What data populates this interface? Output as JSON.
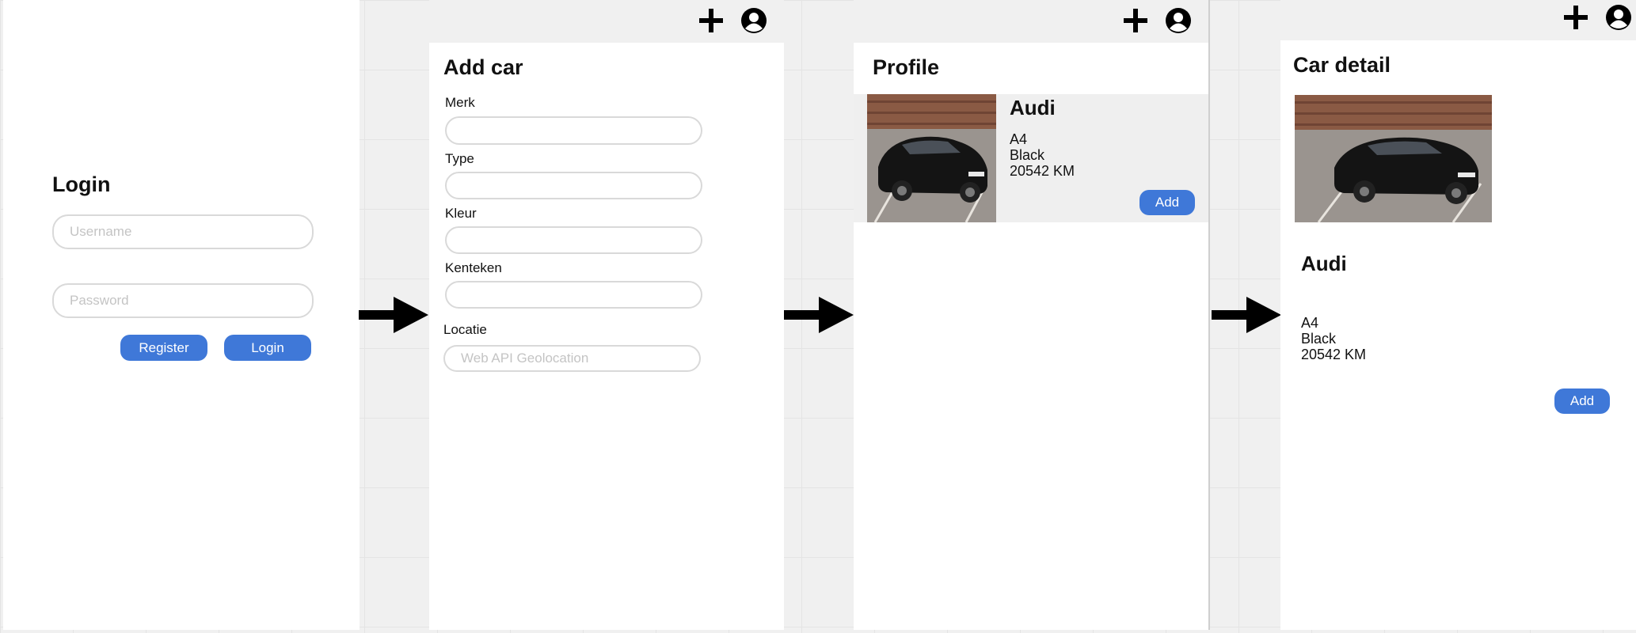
{
  "icon_names": [
    "plus-icon",
    "user-circle-icon",
    "arrow-right-icon"
  ],
  "colors": {
    "accent": "#3f78d8",
    "canvas": "#f0f0f0",
    "topbar": "#f0f0f0",
    "card": "#efefef",
    "field_border": "#d9d9d9"
  },
  "login": {
    "title": "Login",
    "username_placeholder": "Username",
    "password_placeholder": "Password",
    "register_label": "Register",
    "login_label": "Login"
  },
  "add_car": {
    "title": "Add car",
    "merk_label": "Merk",
    "type_label": "Type",
    "kleur_label": "Kleur",
    "kenteken_label": "Kenteken",
    "locatie_label": "Locatie",
    "locatie_placeholder": "Web API Geolocation"
  },
  "profile": {
    "title": "Profile",
    "car": {
      "brand": "Audi",
      "model": "A4",
      "color": "Black",
      "mileage": "20542 KM"
    },
    "add_label": "Add"
  },
  "car_detail": {
    "title": "Car detail",
    "brand": "Audi",
    "model": "A4",
    "color": "Black",
    "mileage": "20542 KM",
    "add_label": "Add"
  }
}
